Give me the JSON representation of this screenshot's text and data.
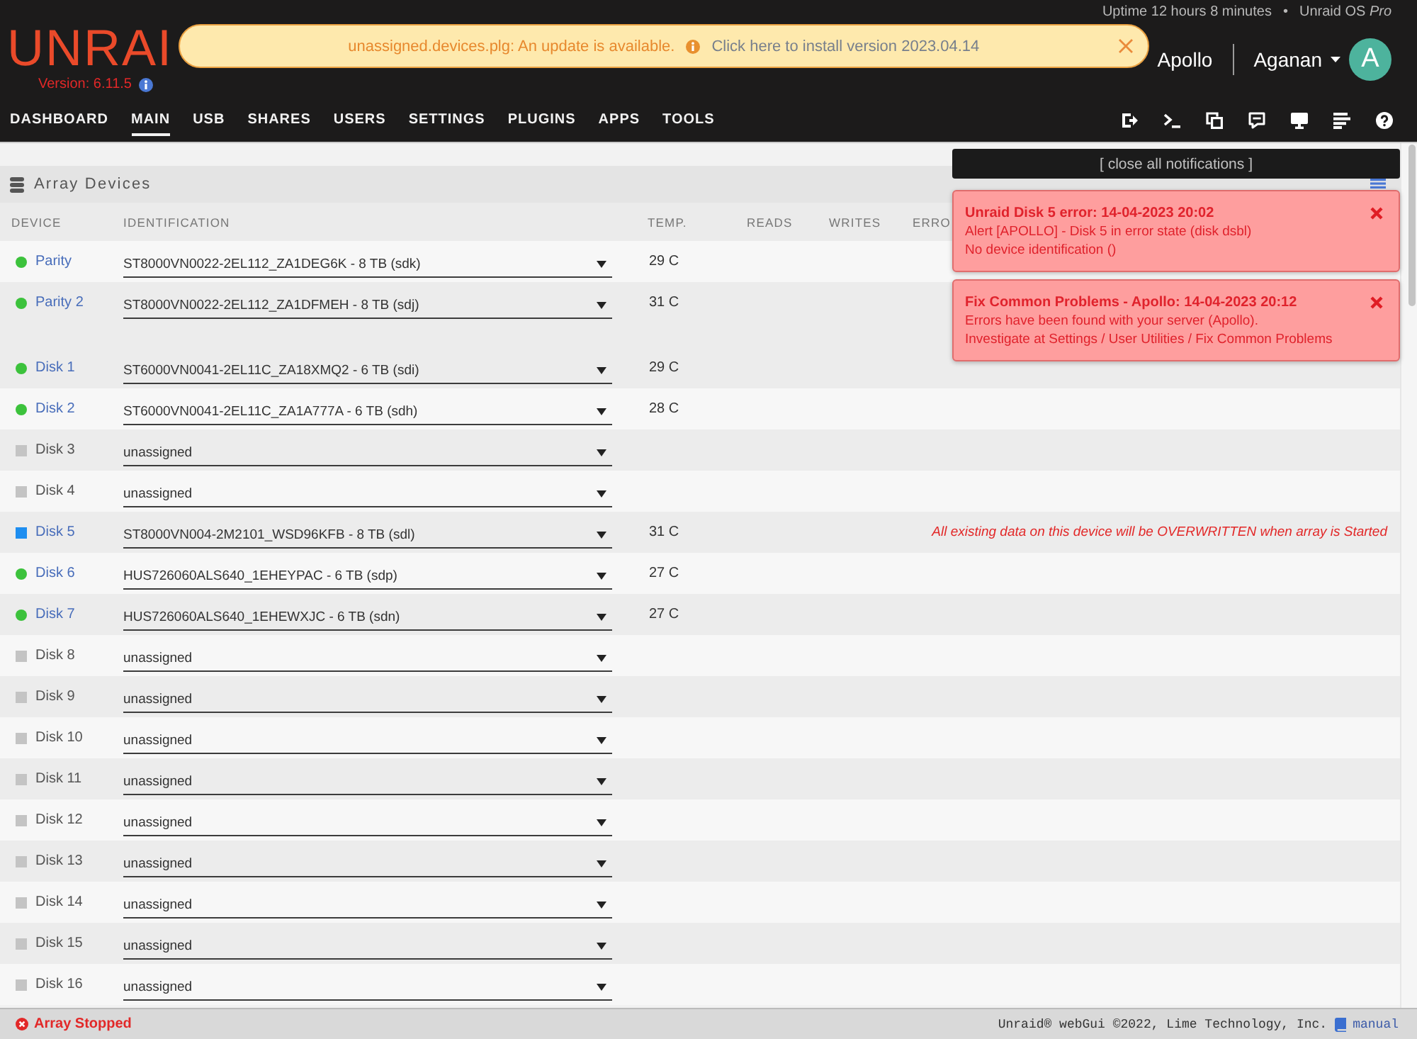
{
  "header": {
    "uptime": "Uptime 12 hours 8 minutes",
    "separator": "•",
    "license": "Unraid OS *Pro*",
    "logo": "UNRAI",
    "version": "Version: 6.11.5",
    "server_name": "Apollo",
    "user_name": "Aganan",
    "avatar_initial": "A"
  },
  "update_banner": {
    "message": "unassigned.devices.plg: An update is available.",
    "link": "Click here to install version 2023.04.14"
  },
  "nav": {
    "tabs": [
      {
        "label": "DASHBOARD",
        "selected": false
      },
      {
        "label": "MAIN",
        "selected": true
      },
      {
        "label": "USB",
        "selected": false
      },
      {
        "label": "SHARES",
        "selected": false
      },
      {
        "label": "USERS",
        "selected": false
      },
      {
        "label": "SETTINGS",
        "selected": false
      },
      {
        "label": "PLUGINS",
        "selected": false
      },
      {
        "label": "APPS",
        "selected": false
      },
      {
        "label": "TOOLS",
        "selected": false
      }
    ]
  },
  "array_devices": {
    "title": "Array Devices",
    "columns": [
      "DEVICE",
      "IDENTIFICATION",
      "TEMP.",
      "READS",
      "WRITES",
      "ERRO"
    ],
    "parity": [
      {
        "name": "Parity",
        "kind": "dot",
        "color": "#3cc23c",
        "assigned": true,
        "identification": "ST8000VN0022-2EL112_ZA1DEG6K - 8 TB (sdk)",
        "temp": "29 C"
      },
      {
        "name": "Parity 2",
        "kind": "dot",
        "color": "#3cc23c",
        "assigned": true,
        "identification": "ST8000VN0022-2EL112_ZA1DFMEH - 8 TB (sdj)",
        "temp": "31 C"
      }
    ],
    "disks": [
      {
        "name": "Disk 1",
        "kind": "dot",
        "color": "#3cc23c",
        "assigned": true,
        "identification": "ST6000VN0041-2EL11C_ZA18XMQ2 - 6 TB (sdi)",
        "temp": "29 C"
      },
      {
        "name": "Disk 2",
        "kind": "dot",
        "color": "#3cc23c",
        "assigned": true,
        "identification": "ST6000VN0041-2EL11C_ZA1A777A - 6 TB (sdh)",
        "temp": "28 C"
      },
      {
        "name": "Disk 3",
        "kind": "square",
        "color": "#c4c4c4",
        "assigned": false,
        "identification": "unassigned"
      },
      {
        "name": "Disk 4",
        "kind": "square",
        "color": "#c4c4c4",
        "assigned": false,
        "identification": "unassigned"
      },
      {
        "name": "Disk 5",
        "kind": "square",
        "color": "#1e8ef0",
        "assigned": true,
        "identification": "ST8000VN004-2M2101_WSD96KFB - 8 TB (sdl)",
        "temp": "31 C",
        "warning": "All existing data on this device will be OVERWRITTEN when array is Started"
      },
      {
        "name": "Disk 6",
        "kind": "dot",
        "color": "#3cc23c",
        "assigned": true,
        "identification": "HUS726060ALS640_1EHEYPAC - 6 TB (sdp)",
        "temp": "27 C"
      },
      {
        "name": "Disk 7",
        "kind": "dot",
        "color": "#3cc23c",
        "assigned": true,
        "identification": "HUS726060ALS640_1EHEWXJC - 6 TB (sdn)",
        "temp": "27 C"
      },
      {
        "name": "Disk 8",
        "kind": "square",
        "color": "#c4c4c4",
        "assigned": false,
        "identification": "unassigned"
      },
      {
        "name": "Disk 9",
        "kind": "square",
        "color": "#c4c4c4",
        "assigned": false,
        "identification": "unassigned"
      },
      {
        "name": "Disk 10",
        "kind": "square",
        "color": "#c4c4c4",
        "assigned": false,
        "identification": "unassigned"
      },
      {
        "name": "Disk 11",
        "kind": "square",
        "color": "#c4c4c4",
        "assigned": false,
        "identification": "unassigned"
      },
      {
        "name": "Disk 12",
        "kind": "square",
        "color": "#c4c4c4",
        "assigned": false,
        "identification": "unassigned"
      },
      {
        "name": "Disk 13",
        "kind": "square",
        "color": "#c4c4c4",
        "assigned": false,
        "identification": "unassigned"
      },
      {
        "name": "Disk 14",
        "kind": "square",
        "color": "#c4c4c4",
        "assigned": false,
        "identification": "unassigned"
      },
      {
        "name": "Disk 15",
        "kind": "square",
        "color": "#c4c4c4",
        "assigned": false,
        "identification": "unassigned"
      },
      {
        "name": "Disk 16",
        "kind": "square",
        "color": "#c4c4c4",
        "assigned": false,
        "identification": "unassigned"
      }
    ]
  },
  "notifications": {
    "close_all": "[ close all notifications ]",
    "items": [
      {
        "title": "Unraid Disk 5 error: 14-04-2023 20:02",
        "lines": [
          "Alert [APOLLO] - Disk 5 in error state (disk dsbl)",
          "No device identification ()"
        ]
      },
      {
        "title": "Fix Common Problems - Apollo: 14-04-2023 20:12",
        "lines": [
          "Errors have been found with your server (Apollo).",
          "Investigate at Settings / User Utilities / Fix Common Problems"
        ]
      }
    ]
  },
  "status_bar": {
    "state": "Array Stopped",
    "credit": "Unraid® webGui ©2022, Lime Technology, Inc.",
    "manual_link": "manual"
  }
}
